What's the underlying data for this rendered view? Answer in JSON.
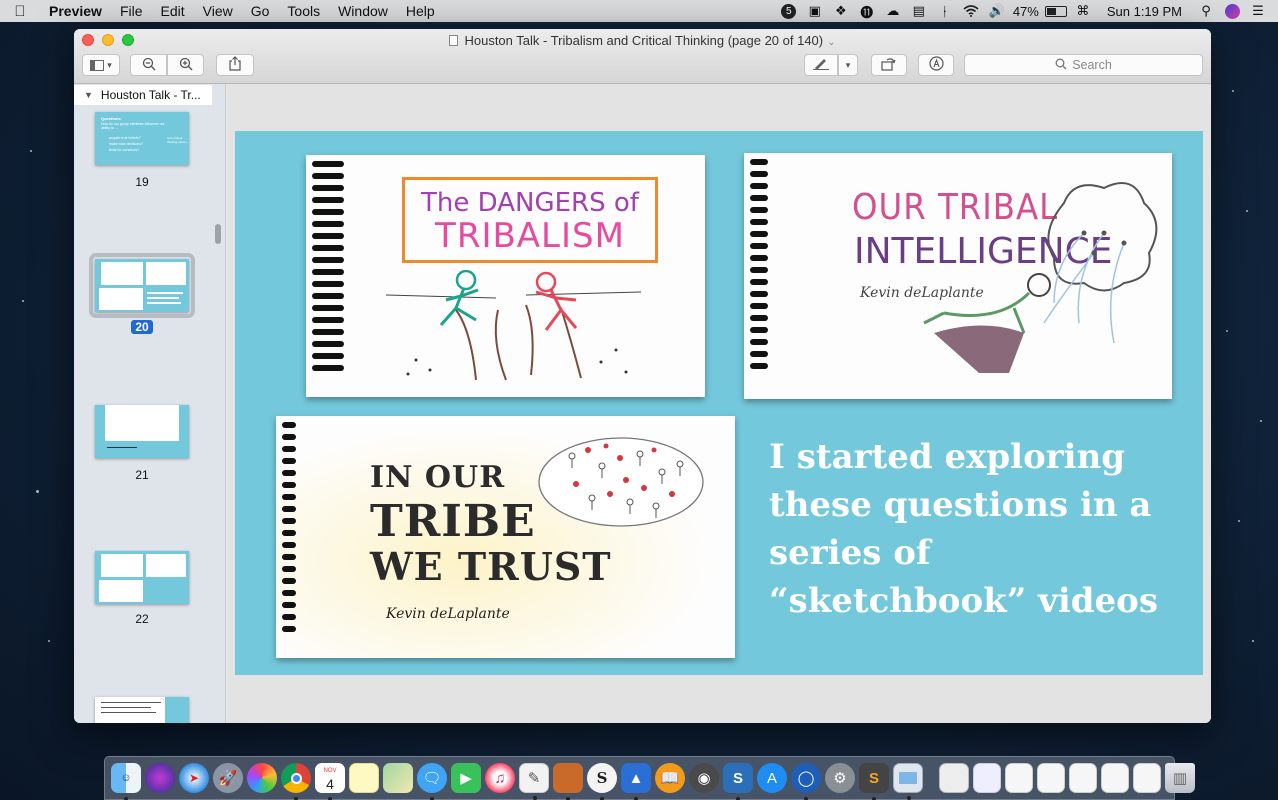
{
  "menubar": {
    "app_name": "Preview",
    "menus": [
      "File",
      "Edit",
      "View",
      "Go",
      "Tools",
      "Window",
      "Help"
    ],
    "battery": "47%",
    "clock": "Sun 1:19 PM"
  },
  "window": {
    "title": "Houston Talk - Tribalism and Critical Thinking (page 20 of 140)",
    "search_placeholder": "Search"
  },
  "sidebar": {
    "header": "Houston Talk - Tr...",
    "thumbnails": [
      {
        "label": "19",
        "title": "Questions:",
        "subtitle": "How do our group identities influence our ability to ...",
        "bullets": [
          "acquire true beliefs?",
          "make wise decisions?",
          "think for ourselves?"
        ],
        "side": "core critical thinking values"
      },
      {
        "label": "20",
        "selected": true
      },
      {
        "label": "21"
      },
      {
        "label": "22"
      }
    ]
  },
  "slide": {
    "card1": {
      "line1": "The DANGERS of",
      "line2": "TRIBALISM"
    },
    "card2": {
      "line1": "OUR TRIBAL",
      "line2": "INTELLIGENCE",
      "author": "Kevin deLaplante"
    },
    "card3": {
      "line1": "IN OUR",
      "line2": "TRIBE",
      "line3": "WE TRUST",
      "author": "Kevin deLaplante"
    },
    "text": "I started exploring these questions in a series of “sketchbook” videos"
  },
  "colors": {
    "slide_bg": "#74c8dc",
    "accent_selected": "#1f69cf"
  },
  "dock": {
    "items": [
      "finder-icon",
      "siri-icon",
      "safari-icon",
      "launchpad-icon",
      "photos-icon",
      "chrome-icon",
      "calendar-icon",
      "notes-icon",
      "maps-icon",
      "messages-icon",
      "facetime-icon",
      "itunes-icon",
      "textedit-icon",
      "books-icon",
      "scrivener-icon",
      "keynote-icon",
      "ibooks-icon",
      "photo-booth-icon",
      "snagit-icon",
      "app-store-icon",
      "1password-icon",
      "system-preferences-icon",
      "sublime-icon",
      "preview-icon",
      "docs-icon",
      "trash-icon"
    ],
    "calendar_day": "4",
    "calendar_month": "NOV"
  }
}
